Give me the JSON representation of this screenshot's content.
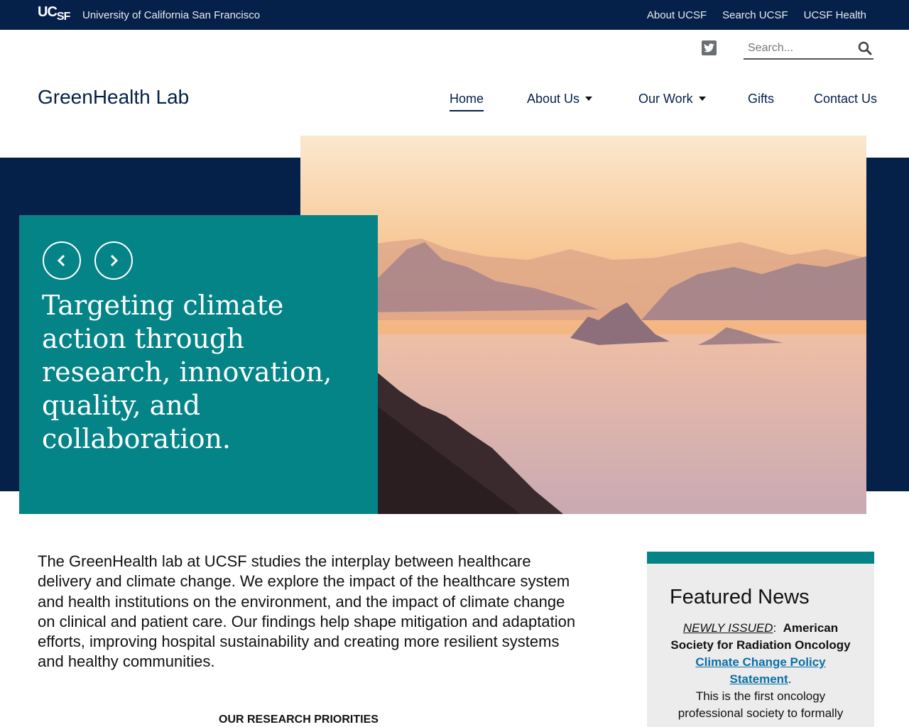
{
  "topbar": {
    "logo_main": "UC",
    "logo_sub": "SF",
    "university": "University of California San Francisco",
    "links": [
      "About UCSF",
      "Search UCSF",
      "UCSF Health"
    ]
  },
  "header": {
    "search_placeholder": "Search...",
    "site_title": "GreenHealth Lab"
  },
  "nav": {
    "home": "Home",
    "about": "About Us",
    "work": "Our Work",
    "gifts": "Gifts",
    "contact": "Contact Us"
  },
  "hero": {
    "headline": "Targeting climate action through research, innovation, quality, and collaboration."
  },
  "main": {
    "intro": "The GreenHealth lab at UCSF studies the interplay between healthcare delivery and climate change. We explore the impact of the healthcare system and health institutions on the environment, and the impact of climate change on clinical and patient care. Our findings help shape mitigation and adaptation efforts, improving hospital sustainability and creating more resilient systems and healthy communities.",
    "priorities_heading": "OUR RESEARCH PRIORITIES"
  },
  "news": {
    "title": "Featured News",
    "tag": "NEWLY ISSUED",
    "colon": ":",
    "org": "American Society for Radiation Oncology",
    "link_text": "Climate Change Policy Statement",
    "period": ".",
    "body": "This is the first oncology professional society to formally"
  },
  "colors": {
    "navy": "#052049",
    "teal": "#058488",
    "link": "#0a6fa8"
  }
}
